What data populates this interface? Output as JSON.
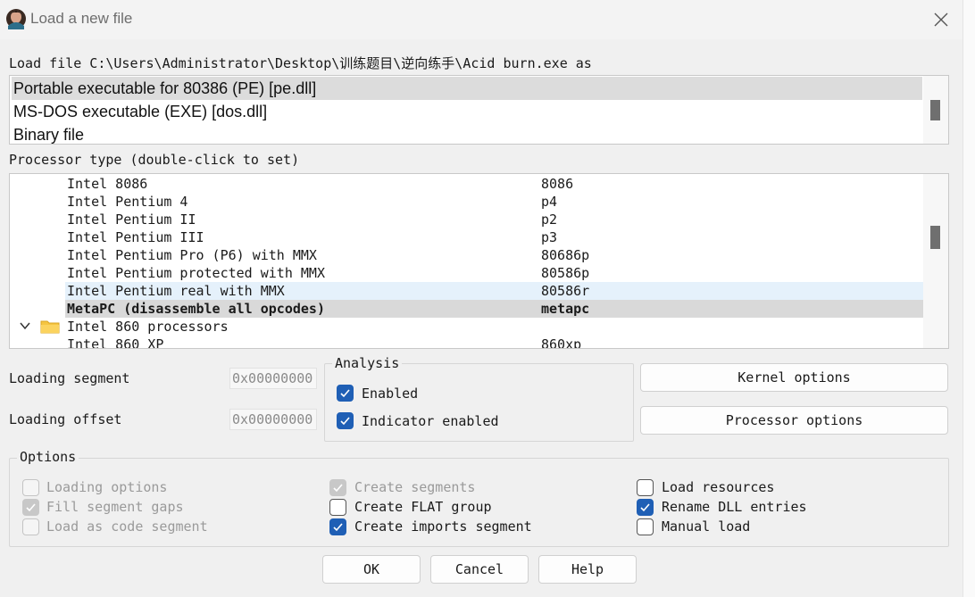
{
  "window": {
    "title": "Load a new file"
  },
  "load_file_label": "Load file C:\\Users\\Administrator\\Desktop\\训练题目\\逆向练手\\Acid burn.exe as",
  "file_types": [
    {
      "label": "Portable executable for 80386 (PE) [pe.dll]",
      "selected": true
    },
    {
      "label": "MS-DOS executable (EXE) [dos.dll]",
      "selected": false
    },
    {
      "label": "Binary file",
      "selected": false
    }
  ],
  "processor_label": "Processor type (double-click to set)",
  "processors": [
    {
      "name": "Intel 8086",
      "code": "8086"
    },
    {
      "name": "Intel Pentium 4",
      "code": "p4"
    },
    {
      "name": "Intel Pentium II",
      "code": "p2"
    },
    {
      "name": "Intel Pentium III",
      "code": "p3"
    },
    {
      "name": "Intel Pentium Pro (P6) with MMX",
      "code": "80686p"
    },
    {
      "name": "Intel Pentium protected with MMX",
      "code": "80586p"
    },
    {
      "name": "Intel Pentium real with MMX",
      "code": "80586r"
    },
    {
      "name": "MetaPC (disassemble all opcodes)",
      "code": "metapc"
    },
    {
      "name": "Intel 860 processors",
      "code": ""
    },
    {
      "name": "Intel 860 XP",
      "code": "860xp"
    }
  ],
  "loading_segment": {
    "label": "Loading segment",
    "value": "0x00000000"
  },
  "loading_offset": {
    "label": "Loading offset",
    "value": "0x00000000"
  },
  "analysis": {
    "title": "Analysis",
    "enabled_label": "Enabled",
    "indicator_label": "Indicator enabled"
  },
  "buttons": {
    "kernel": "Kernel options",
    "processor": "Processor options",
    "ok": "OK",
    "cancel": "Cancel",
    "help": "Help"
  },
  "options": {
    "title": "Options",
    "col1": [
      "Loading options",
      "Fill segment gaps",
      "Load as code segment"
    ],
    "col2": [
      "Create segments",
      "Create FLAT group",
      "Create imports segment"
    ],
    "col3": [
      "Load resources",
      "Rename DLL entries",
      "Manual load"
    ]
  },
  "icons": {
    "app": "ida-app-icon",
    "close": "close-icon",
    "chevron": "chevron-down-icon",
    "folder": "folder-icon",
    "check": "checkmark-icon"
  },
  "colors": {
    "checkbox_on": "#1f5fb5",
    "folder": "#f5c542",
    "selection": "#d9d9d9",
    "hover": "#e5f1fb"
  }
}
